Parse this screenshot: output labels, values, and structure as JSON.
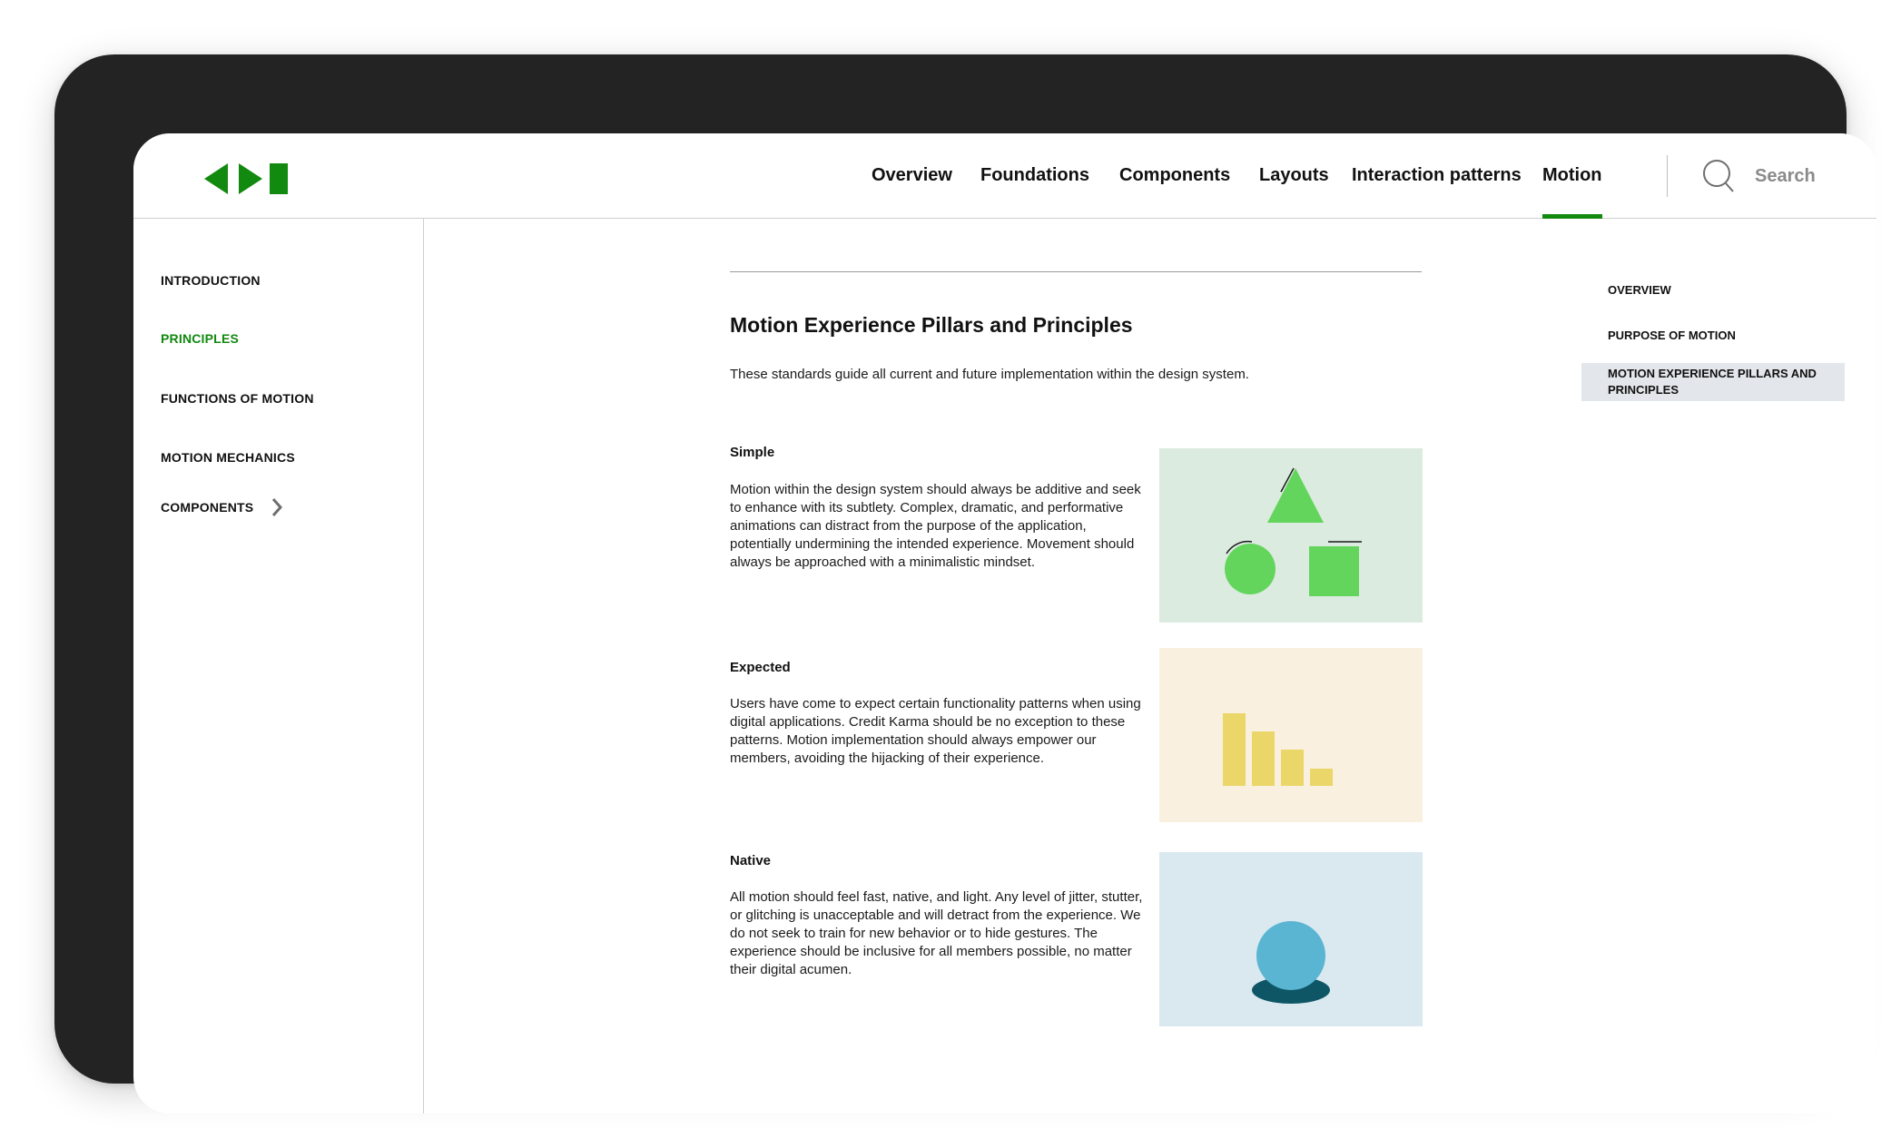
{
  "header": {
    "nav": [
      {
        "label": "Overview"
      },
      {
        "label": "Foundations"
      },
      {
        "label": "Components"
      },
      {
        "label": "Layouts"
      },
      {
        "label": "Interaction patterns"
      },
      {
        "label": "Motion"
      }
    ],
    "search_label": "Search",
    "active_nav": "Motion"
  },
  "sidebar": {
    "items": [
      {
        "label": "INTRODUCTION"
      },
      {
        "label": "PRINCIPLES"
      },
      {
        "label": "FUNCTIONS OF MOTION"
      },
      {
        "label": "MOTION MECHANICS"
      },
      {
        "label": "COMPONENTS"
      }
    ],
    "active_item": "PRINCIPLES"
  },
  "main": {
    "title": "Motion Experience Pillars and Principles",
    "intro": "These standards guide all current and future implementation within the design system.",
    "sections": [
      {
        "title": "Simple",
        "body": "Motion within the design system should always be additive and seek to enhance with its subtlety. Complex, dramatic, and performative animations can distract from the purpose of the application, potentially undermining the intended experience. Movement should always be approached with a minimalistic mindset."
      },
      {
        "title": "Expected",
        "body": "Users have come to expect certain functionality patterns when using digital applications. Credit Karma should be no exception to these patterns. Motion implementation should always empower our members, avoiding the hijacking of their experience."
      },
      {
        "title": "Native",
        "body": "All motion should feel fast, native, and light. Any level of jitter, stutter, or glitching is unacceptable and will detract from the experience. We do not seek to train for new behavior or to hide gestures. The experience should be inclusive for all members possible, no matter their digital acumen."
      }
    ]
  },
  "toc": {
    "items": [
      {
        "label": "OVERVIEW"
      },
      {
        "label": "PURPOSE OF MOTION"
      },
      {
        "label": "MOTION EXPERIENCE PILLARS AND PRINCIPLES"
      }
    ],
    "active_item": "MOTION EXPERIENCE PILLARS AND PRINCIPLES"
  },
  "colors": {
    "brand_green": "#12890f",
    "simple_bg": "#dcebe0",
    "shape_green": "#63d55c",
    "expected_bg": "#faf0e0",
    "bar_yellow": "#ebd66a",
    "native_bg": "#dae8ef",
    "ball_blue": "#5ab5d2",
    "shadow_teal": "#0e5666",
    "toc_active_bg": "#e3e7eb"
  },
  "icons": {
    "logo": "prev-play-stop-logo",
    "search": "search-icon",
    "chevron": "chevron-right-icon"
  }
}
